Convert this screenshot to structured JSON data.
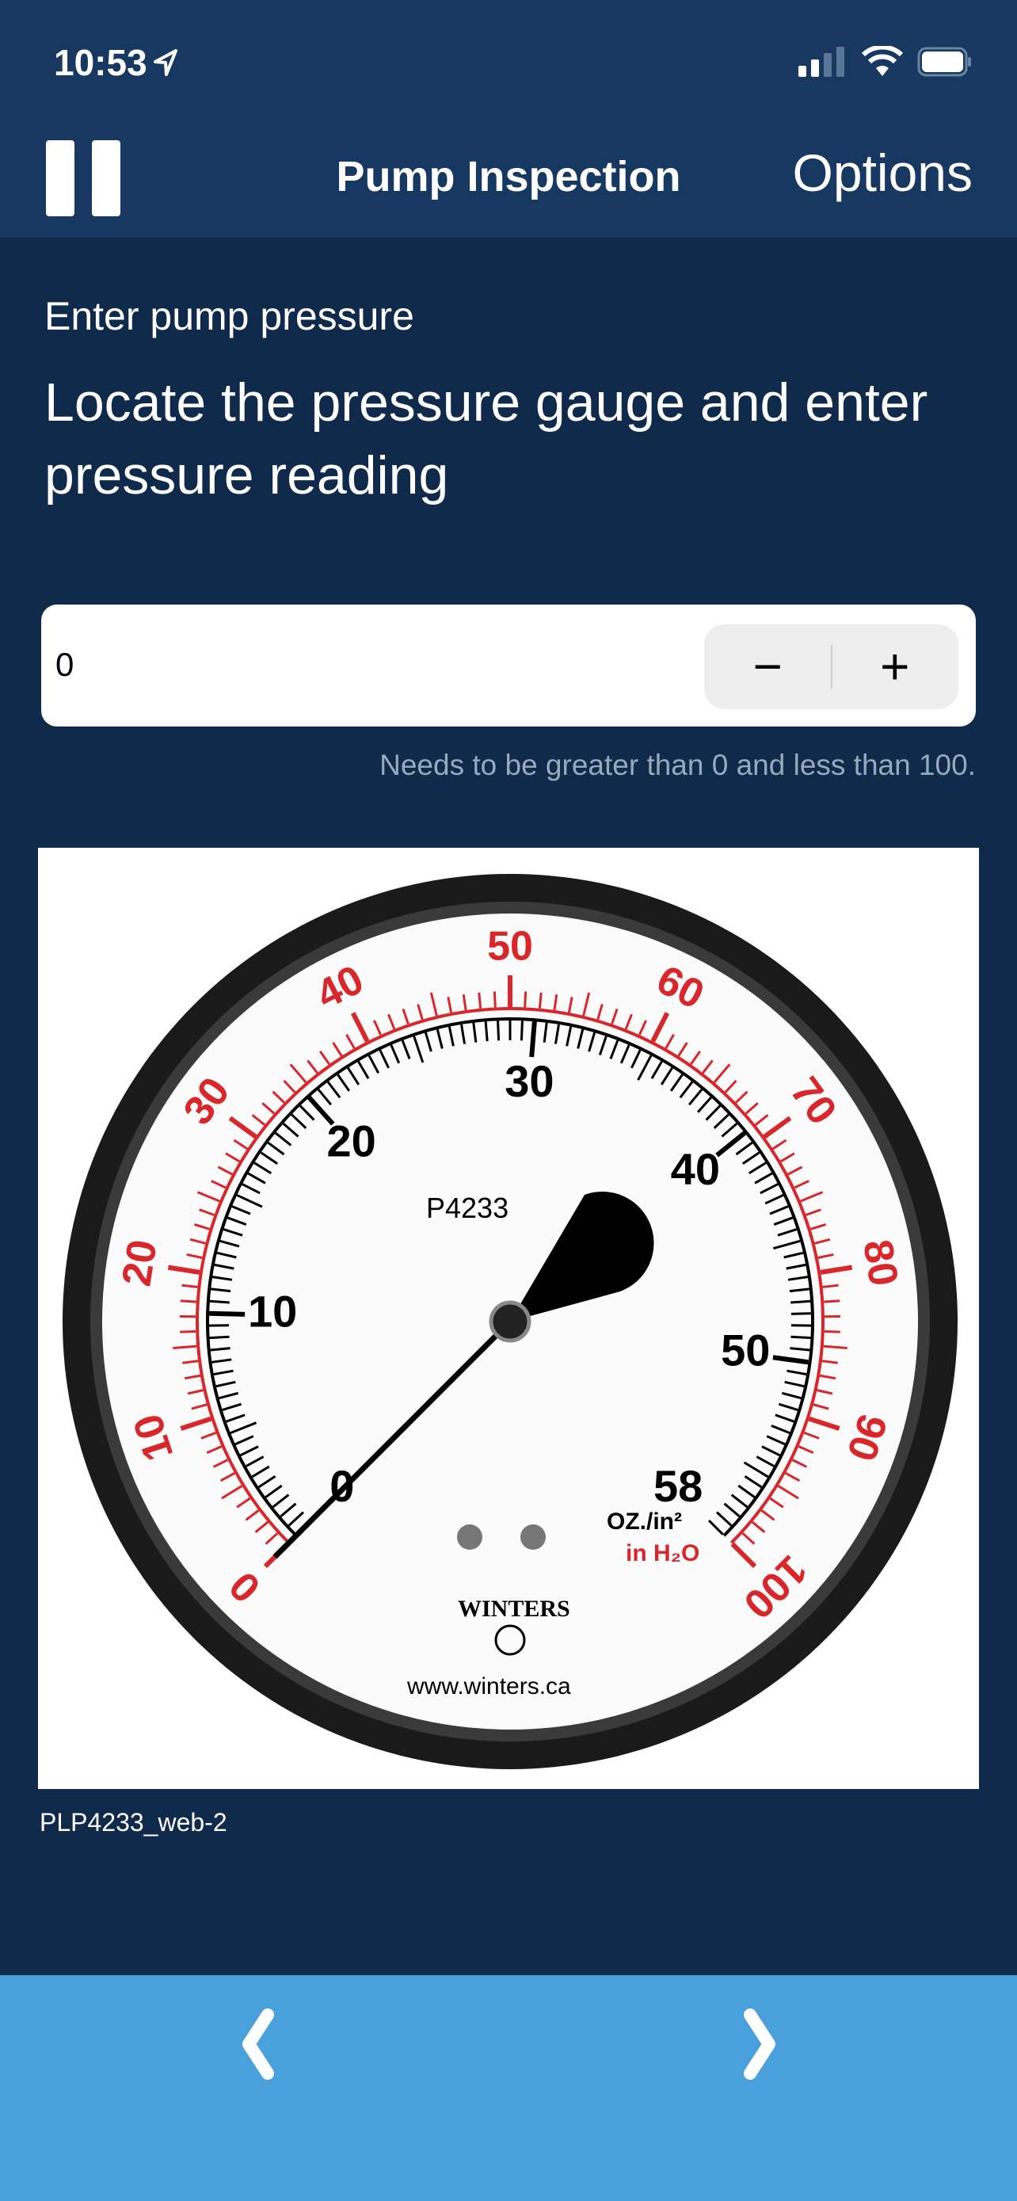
{
  "status_bar": {
    "time": "10:53",
    "icons": [
      "location-arrow-icon",
      "cellular-signal-icon",
      "wifi-icon",
      "battery-icon"
    ]
  },
  "nav_bar": {
    "title": "Pump Inspection",
    "options_label": "Options",
    "left_icon": "pause-icon"
  },
  "step": {
    "label": "Enter pump pressure",
    "instruction": "Locate the pressure gauge and enter pressure reading"
  },
  "pressure_input": {
    "value": "0",
    "decrement_label": "−",
    "increment_label": "+",
    "helper": "Needs to be greater than 0 and less than 100."
  },
  "gauge_image": {
    "caption": "PLP4233_web-2",
    "model": "P4233",
    "unit_primary": "OZ./in²",
    "unit_secondary": "in H₂O",
    "brand": "WINTERS",
    "url": "www.winters.ca",
    "outer_scale_labels": [
      "0",
      "10",
      "20",
      "30",
      "40",
      "50",
      "60",
      "70",
      "80",
      "90",
      "100"
    ],
    "inner_scale_labels": [
      "0",
      "10",
      "20",
      "30",
      "40",
      "50",
      "58"
    ],
    "needle_reading": 0,
    "colors": {
      "outer_scale": "#d9262b",
      "inner_scale": "#000000"
    }
  },
  "footer": {
    "prev_icon": "chevron-left-icon",
    "next_icon": "chevron-right-icon",
    "background": "#4aa0db"
  }
}
